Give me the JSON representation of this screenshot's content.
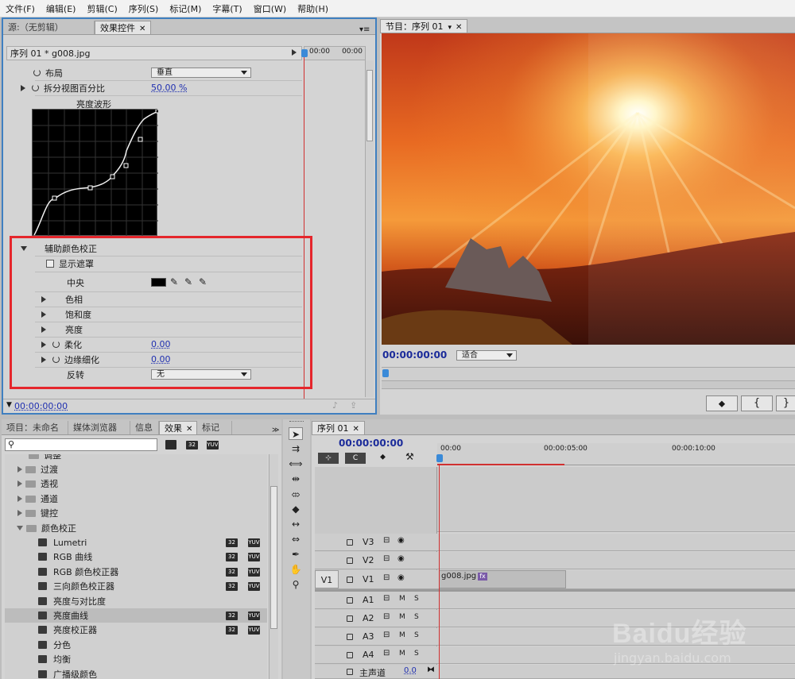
{
  "menu": [
    "文件(F)",
    "编辑(E)",
    "剪辑(C)",
    "序列(S)",
    "标记(M)",
    "字幕(T)",
    "窗口(W)",
    "帮助(H)"
  ],
  "source_panel": {
    "tab_source": "源:（无剪辑）",
    "tab_effects": "效果控件"
  },
  "effect_controls": {
    "sequence_label": "序列 01 * g008.jpg",
    "ruler_start": "00:00",
    "ruler_end": "00:00",
    "layout_label": "布局",
    "layout_value": "垂直",
    "split_label": "拆分视图百分比",
    "split_value": "50.00 %",
    "waveform_title": "亮度波形",
    "secondary_title": "辅助颜色校正",
    "show_mask": "显示遮罩",
    "center_label": "中央",
    "hue": "色相",
    "saturation": "饱和度",
    "luma": "亮度",
    "soften_label": "柔化",
    "soften_value": "0.00",
    "edge_label": "边缘细化",
    "edge_value": "0.00",
    "invert_label": "反转",
    "invert_value": "无",
    "timecode": "00:00:00:00"
  },
  "program": {
    "tab": "节目：序列 01",
    "timecode": "00:00:00:00",
    "fit": "适合"
  },
  "project_panel": {
    "tabs": [
      "项目：未命名",
      "媒体浏览器",
      "信息",
      "效果",
      "标记"
    ],
    "folders": [
      "调整",
      "过渡",
      "透视",
      "通道",
      "键控",
      "颜色校正"
    ],
    "effects": [
      {
        "name": "Lumetri",
        "badges": [
          "32",
          "YUV"
        ]
      },
      {
        "name": "RGB 曲线",
        "badges": [
          "32",
          "YUV"
        ]
      },
      {
        "name": "RGB 颜色校正器",
        "badges": [
          "32",
          "YUV"
        ]
      },
      {
        "name": "三向颜色校正器",
        "badges": [
          "32",
          "YUV"
        ]
      },
      {
        "name": "亮度与对比度",
        "badges": []
      },
      {
        "name": "亮度曲线",
        "badges": [
          "32",
          "YUV"
        ]
      },
      {
        "name": "亮度校正器",
        "badges": [
          "32",
          "YUV"
        ]
      },
      {
        "name": "分色",
        "badges": []
      },
      {
        "name": "均衡",
        "badges": []
      },
      {
        "name": "广播级颜色",
        "badges": []
      }
    ],
    "badge_labels": [
      "32",
      "YUV"
    ]
  },
  "timeline": {
    "tab": "序列 01",
    "timecode": "00:00:00:00",
    "ruler": [
      "00:00",
      "00:00:05:00",
      "00:00:10:00"
    ],
    "tracks_video": [
      "V3",
      "V2",
      "V1"
    ],
    "tracks_audio": [
      "A1",
      "A2",
      "A3",
      "A4"
    ],
    "source_patch": "V1",
    "master": "主声道",
    "master_value": "0.0",
    "clip": "g008.jpg",
    "fx": "fx",
    "m": "M",
    "s": "S"
  },
  "watermark": {
    "text": "Baidu经验",
    "url": "jingyan.baidu.com"
  },
  "colors": {
    "highlight_box": "#e5262c",
    "playhead": "#d03030",
    "link": "#2030b0"
  }
}
